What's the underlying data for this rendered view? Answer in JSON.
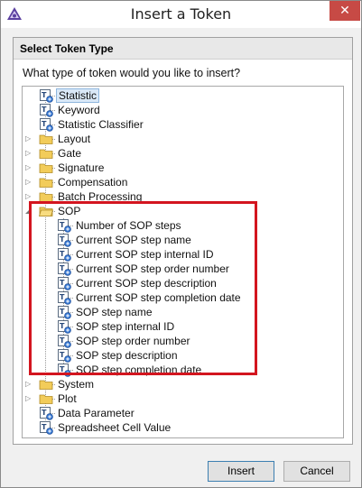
{
  "window": {
    "title": "Insert a Token",
    "close_glyph": "✕"
  },
  "group": {
    "title": "Select Token Type",
    "question": "What type of token would you like to insert?"
  },
  "tree": {
    "top_items": [
      {
        "label": "Statistic",
        "type": "token",
        "selected": true
      },
      {
        "label": "Keyword",
        "type": "token"
      },
      {
        "label": "Statistic Classifier",
        "type": "token"
      },
      {
        "label": "Layout",
        "type": "folder",
        "expanded": false
      },
      {
        "label": "Gate",
        "type": "folder",
        "expanded": false
      },
      {
        "label": "Signature",
        "type": "folder",
        "expanded": false
      },
      {
        "label": "Compensation",
        "type": "folder",
        "expanded": false
      },
      {
        "label": "Batch Processing",
        "type": "folder",
        "expanded": false
      },
      {
        "label": "SOP",
        "type": "folder",
        "expanded": true
      }
    ],
    "sop_children": [
      "Number of SOP steps",
      "Current SOP step name",
      "Current SOP step internal ID",
      "Current SOP step order number",
      "Current SOP step description",
      "Current SOP step completion date",
      "SOP step name",
      "SOP step internal ID",
      "SOP step order number",
      "SOP step description",
      "SOP step completion date"
    ],
    "bottom_items": [
      {
        "label": "System",
        "type": "folder",
        "expanded": false
      },
      {
        "label": "Plot",
        "type": "folder",
        "expanded": false
      },
      {
        "label": "Data Parameter",
        "type": "token"
      },
      {
        "label": "Spreadsheet Cell Value",
        "type": "token"
      }
    ]
  },
  "buttons": {
    "insert": "Insert",
    "cancel": "Cancel"
  },
  "colors": {
    "highlight_box": "#d3151f",
    "selection": "#d9e8f7",
    "folder": "#f2cc5a"
  }
}
